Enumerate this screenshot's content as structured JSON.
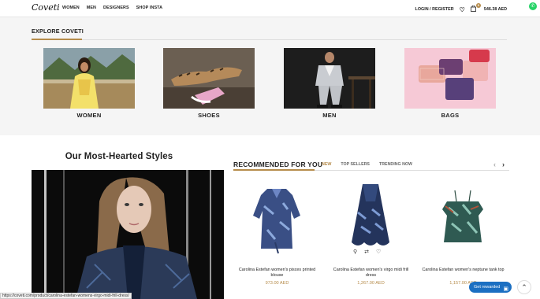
{
  "header": {
    "logo": "Coveti",
    "nav": [
      "WOMEN",
      "MEN",
      "DESIGNERS",
      "SHOP INSTA"
    ],
    "login": "LOGIN / REGISTER",
    "cart_count": "0",
    "cart_total": "546.38 AED"
  },
  "explore": {
    "title": "EXPLORE COVETI",
    "categories": [
      "WOMEN",
      "SHOES",
      "MEN",
      "BAGS"
    ]
  },
  "hearted": {
    "title": "Our Most-Hearted Styles"
  },
  "recommended": {
    "title": "RECOMMENDED FOR YOU",
    "tabs": [
      "NEW",
      "TOP SELLERS",
      "TRENDING NOW"
    ],
    "products": [
      {
        "name": "Carolina Estefan women's pisces printed blouse",
        "price": "973.00 AED"
      },
      {
        "name": "Carolina Estefan women's virgo midi frill dress",
        "price": "1,267.00 AED"
      },
      {
        "name": "Carolina Estefan women's neptune tank top",
        "price": "1,157.00 AED"
      }
    ]
  },
  "statusbar": "https://coveti.com/product/carolina-estefan-womens-virgo-midi-frill-dress/",
  "rewards": "Get rewarded",
  "colors": {
    "accent": "#b68c4b",
    "rewards": "#1b6fc2"
  }
}
